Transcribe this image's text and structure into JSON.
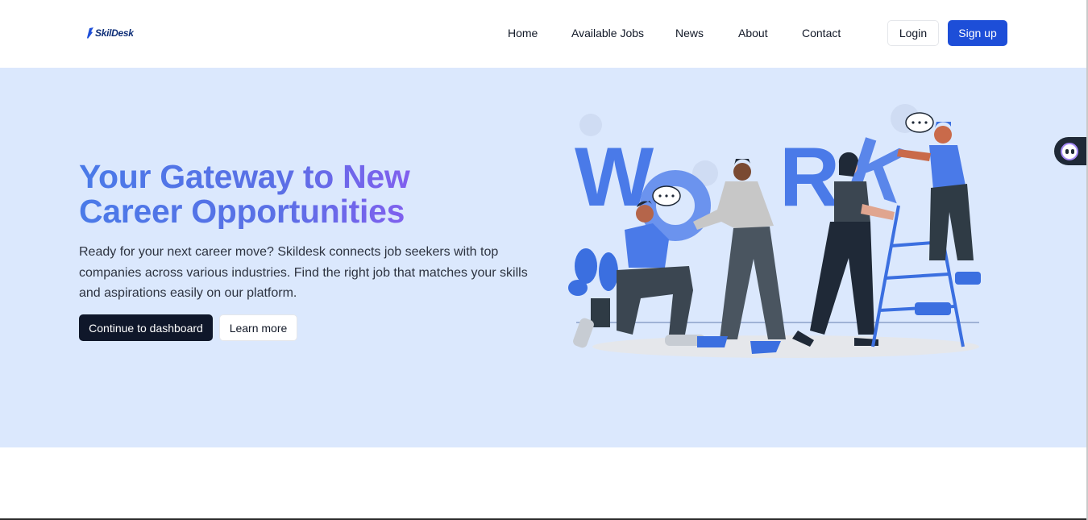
{
  "header": {
    "logo_text": "SkilDesk",
    "nav": [
      {
        "label": "Home"
      },
      {
        "label": "Available Jobs"
      },
      {
        "label": "News"
      },
      {
        "label": "About"
      },
      {
        "label": "Contact"
      }
    ],
    "login_label": "Login",
    "signup_label": "Sign up"
  },
  "hero": {
    "title_line1": "Your Gateway to New",
    "title_line2": "Career Opportunities",
    "description": "Ready for your next career move? Skildesk connects job seekers with top companies across various industries. Find the right job that matches your skills and aspirations easily on our platform.",
    "primary_button": "Continue to dashboard",
    "secondary_button": "Learn more",
    "illustration_word": "WORK"
  },
  "colors": {
    "brand": "#1d4ed8",
    "hero_bg": "#dbe8fd",
    "dark_button": "#0f172a",
    "gradient_start": "#4a7ae8",
    "gradient_end": "#9b5cf2",
    "illustration_blue": "#4a7ae8"
  },
  "icons": {
    "logo": "skildesk-logo-icon",
    "chat": "chat-assistant-icon"
  }
}
